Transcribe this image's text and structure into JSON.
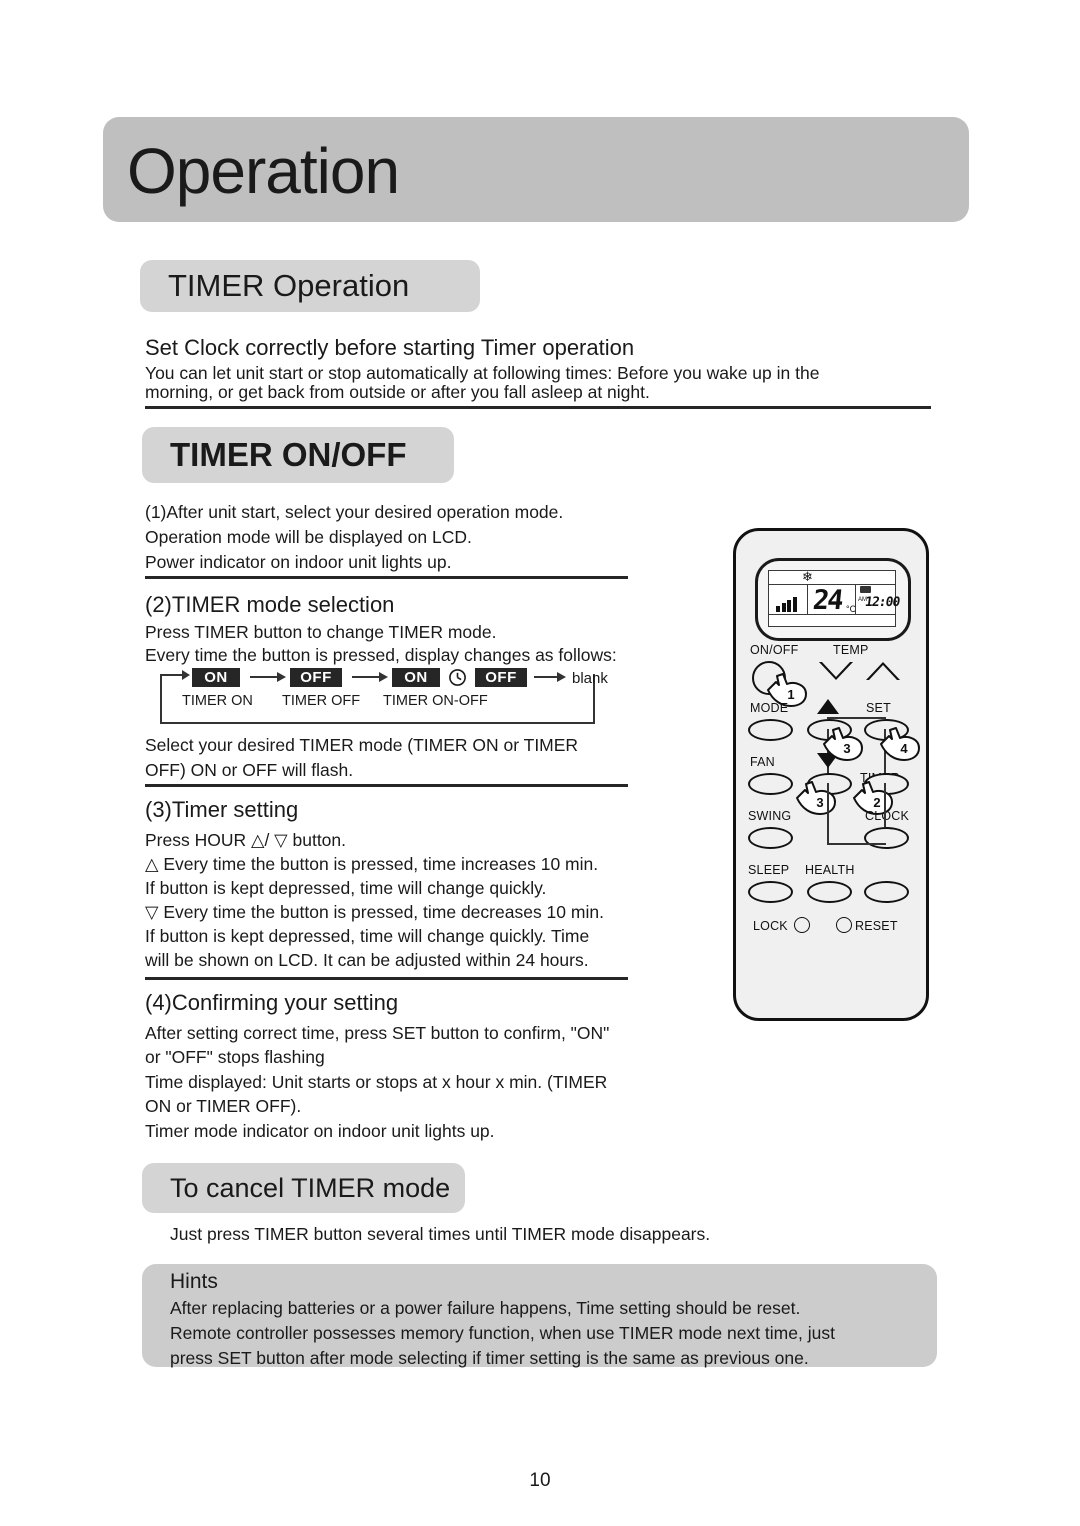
{
  "chapter": {
    "title": "Operation"
  },
  "page_number": "10",
  "sections": {
    "timer_operation": {
      "pill_label": "TIMER Operation",
      "subhead": "Set Clock correctly before starting Timer operation",
      "body_lines": [
        "You can let unit start or stop automatically at following times: Before you wake up in the",
        "morning, or get back from outside or after you fall asleep at night."
      ]
    },
    "timer_on_off": {
      "pill_label": "TIMER ON/OFF",
      "step1": {
        "lines": [
          "(1)After unit start, select your desired operation mode.",
          "Operation mode will be displayed on LCD.",
          "Power indicator on indoor unit lights up."
        ]
      },
      "step2": {
        "heading": "(2)TIMER mode selection",
        "lines": [
          "Press TIMER button to change TIMER mode.",
          "Every time the button is pressed, display changes as follows:"
        ],
        "flow": {
          "tags": [
            "ON",
            "OFF",
            "ON",
            "OFF"
          ],
          "blank_label": "blank",
          "clock_icon": "clock-icon",
          "mode_labels": [
            "TIMER ON",
            "TIMER OFF",
            "TIMER ON-OFF"
          ]
        },
        "after_lines": [
          "Select your desired TIMER mode (TIMER ON or TIMER",
          "OFF) ON or OFF will flash."
        ]
      },
      "step3": {
        "heading": "(3)Timer setting",
        "lines": [
          "Press HOUR △/ ▽ button.",
          "△ Every time the button is pressed, time increases 10 min.",
          "If button is kept depressed, time will change quickly.",
          "▽ Every time the button is pressed, time decreases 10 min.",
          "If button is kept depressed, time will change quickly. Time",
          "will be shown on LCD. It can be adjusted within 24 hours."
        ]
      },
      "step4": {
        "heading": "(4)Confirming your setting",
        "lines": [
          " After setting correct time, press SET button to confirm, \"ON\"",
          "or \"OFF\" stops flashing",
          "Time displayed: Unit starts or stops at x hour x min. (TIMER",
          "ON or TIMER OFF).",
          "Timer mode indicator on indoor unit lights up."
        ]
      }
    },
    "cancel_timer": {
      "pill_label": "To cancel TIMER mode",
      "body": "Just press TIMER button several times until TIMER mode disappears."
    },
    "hints": {
      "title": "Hints",
      "lines": [
        "After replacing batteries or a power failure happens, Time setting should be reset.",
        "Remote controller possesses memory function, when use TIMER mode next time, just",
        "press SET button after mode selecting if timer setting is the same as previous one."
      ]
    }
  },
  "remote": {
    "lcd": {
      "mode_icon": "snowflake-icon",
      "fan_bars": 4,
      "temperature": "24",
      "temperature_unit": "°C",
      "battery_icon": "battery-icon",
      "am_pm": "AM",
      "clock": "12:00"
    },
    "labels": {
      "on_off": "ON/OFF",
      "temp": "TEMP",
      "mode": "MODE",
      "set": "SET",
      "fan": "FAN",
      "timer": "TIMER",
      "swing": "SWING",
      "clock": "CLOCK",
      "sleep": "SLEEP",
      "health": "HEALTH",
      "lock": "LOCK",
      "reset": "RESET"
    },
    "step_markers": [
      "1",
      "3",
      "4",
      "3",
      "2"
    ]
  },
  "colors": {
    "chapter_bar": "#bfbfbf",
    "pill": "#d4d4d4",
    "hints_box": "#cccccc",
    "tag_bg": "#262626",
    "tag_fg": "#ffffff",
    "text": "#1a1a1a",
    "remote_body": "#f0f0f0",
    "remote_outline": "#111111"
  }
}
